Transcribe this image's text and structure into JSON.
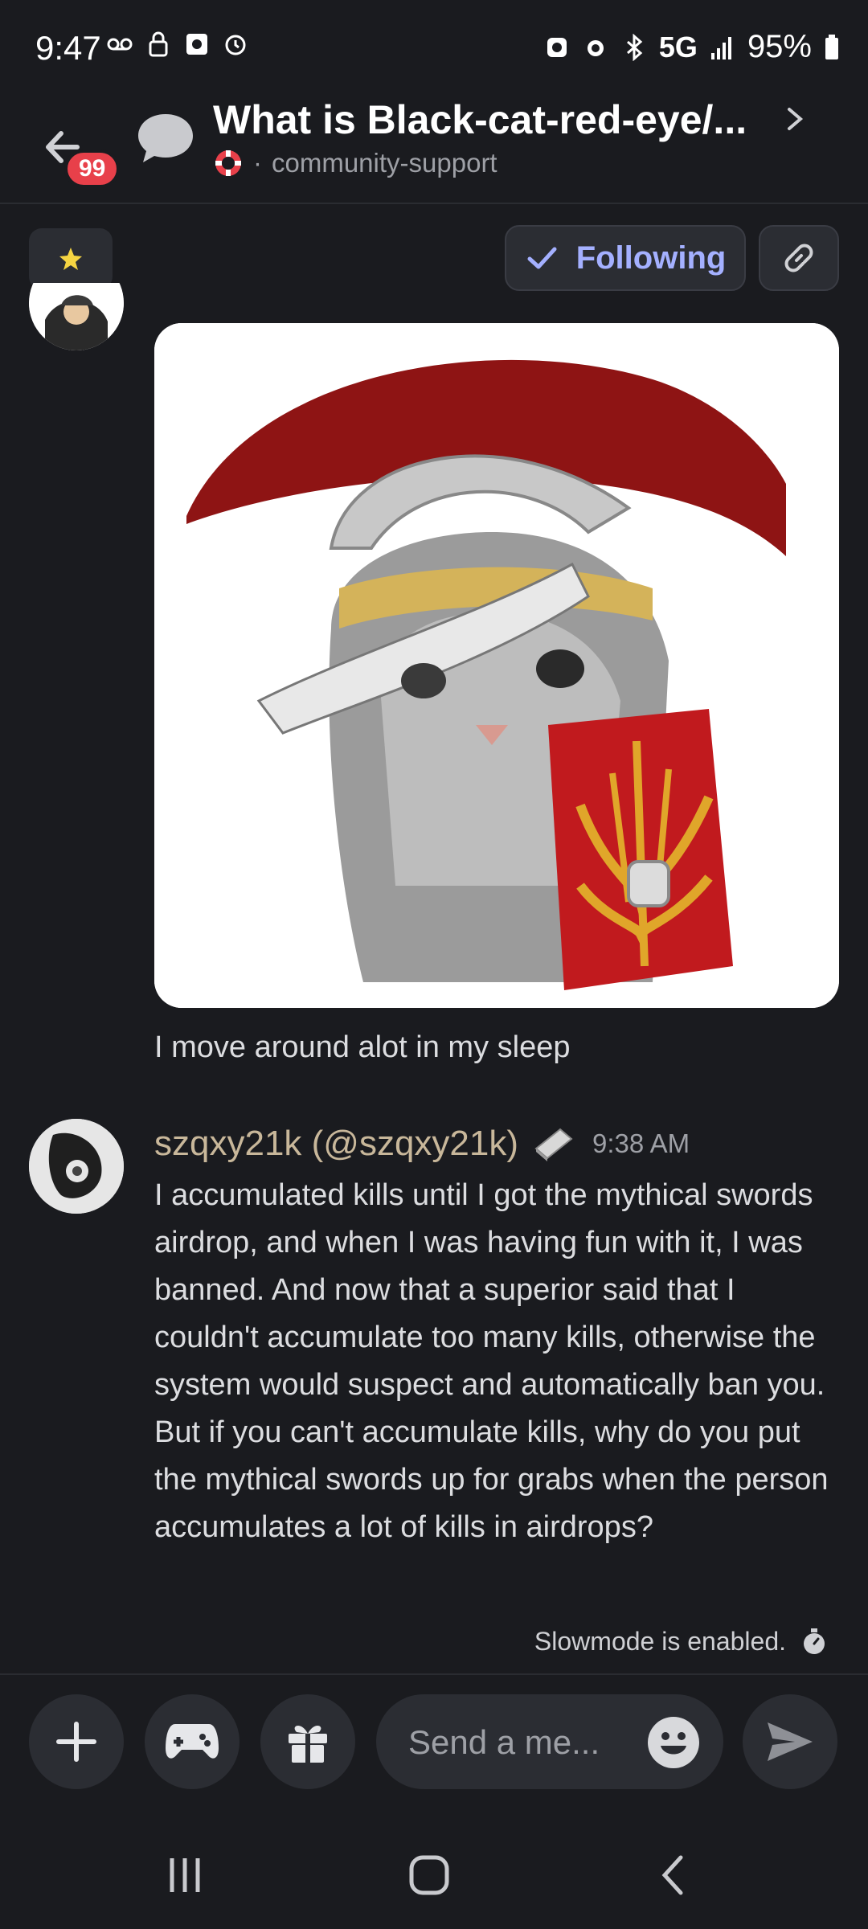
{
  "status_bar": {
    "time": "9:47",
    "network": "5G",
    "battery": "95%"
  },
  "header": {
    "unread_badge": "99",
    "title": "What is Black-cat-red-eye/...",
    "channel": "community-support"
  },
  "actions": {
    "following_label": "Following"
  },
  "messages": [
    {
      "text": "I move around alot in my sleep"
    },
    {
      "author": "szqxy21k (@szqxy21k)",
      "time": "9:38 AM",
      "text": "I accumulated kills until I got the mythical swords airdrop, and when I was having fun with it, I was banned. And now that a superior said that I couldn't accumulate too many kills, otherwise the system would suspect and automatically ban you. But if you can't accumulate kills, why do you put the mythical swords up for grabs when the person accumulates a lot of kills in airdrops?"
    }
  ],
  "slowmode": "Slowmode is enabled.",
  "composer": {
    "placeholder": "Send a me..."
  },
  "colors": {
    "background": "#1a1b1f",
    "accent": "#a4b0ff",
    "badge": "#e8404a",
    "author": "#c8b79a"
  }
}
